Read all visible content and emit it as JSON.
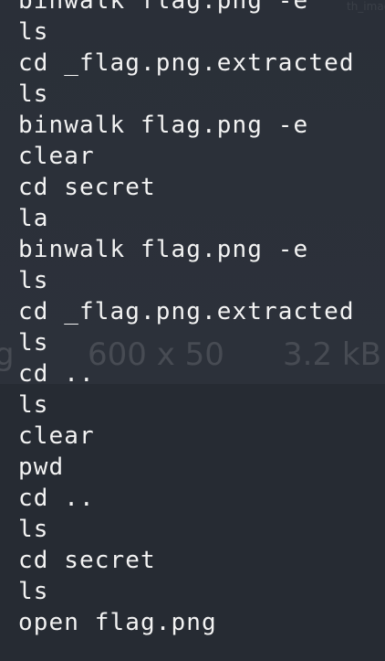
{
  "background": {
    "ghost_corner_text": "th_image",
    "ghost_metadata": {
      "filename_fragment": "g",
      "dimensions": "600 x 50",
      "size": "3.2 kB"
    }
  },
  "terminal": {
    "history": [
      "binwalk flag.png -e",
      "ls",
      "cd _flag.png.extracted",
      "ls",
      "binwalk flag.png -e",
      "clear",
      "cd secret",
      "la",
      "binwalk flag.png -e",
      "ls",
      "cd _flag.png.extracted",
      "ls",
      "cd ..",
      "ls",
      "clear",
      "pwd",
      "cd ..",
      "ls",
      "cd secret",
      "ls",
      "open flag.png"
    ]
  },
  "colors": {
    "background": "#2a2f38",
    "text": "#f3f3f3"
  }
}
